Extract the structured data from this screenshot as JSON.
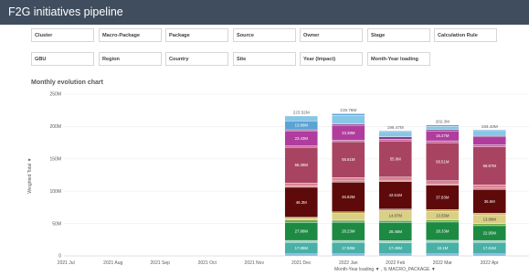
{
  "app": {
    "title": "F2G initiatives pipeline"
  },
  "filters": {
    "row1": [
      "Cluster",
      "Macro-Package",
      "Package",
      "Source",
      "Owner",
      "Stage",
      "Calculation Rule"
    ],
    "row2": [
      "GBU",
      "Region",
      "Country",
      "Site",
      "Year (Impact)",
      "Month-Year loading"
    ]
  },
  "chart_title": "Monthly evolution chart",
  "axis": {
    "ylabel": "Weighted Total",
    "ylabel_arrow": "▼",
    "xlabel": "Month-Year loading  ▼  , ⇅ MACRO_PACKAGE  ▼"
  },
  "colors": {
    "titlebar": "#3f4d5e",
    "blue": "#5ba3d5",
    "lightblue": "#88c6e6",
    "magenta": "#b03d9e",
    "rose": "#a84462",
    "darkred": "#5e0a0a",
    "khaki": "#dbcf86",
    "green": "#1d8a43",
    "teal": "#49b0a6"
  },
  "chart_data": {
    "type": "bar",
    "stacked": true,
    "ylim": [
      0,
      250
    ],
    "yticks": [
      "0",
      "50M",
      "100M",
      "150M",
      "200M",
      "250M"
    ],
    "categories": [
      "2021 Jul",
      "2021 Aug",
      "2021 Sep",
      "2021 Oct",
      "2021 Nov",
      "2021 Dec",
      "2022 Jan",
      "2022 Feb",
      "2022 Mar",
      "2022 Apr"
    ],
    "totals": [
      "",
      "",
      "",
      "",
      "",
      "223.52M",
      "219.76M",
      "196.47M",
      "202.3M",
      "193.43M"
    ],
    "stacks": [
      [],
      [],
      [],
      [],
      [],
      [
        {
          "value": 3,
          "color": "#7fb2dc"
        },
        {
          "value": 17.88,
          "color": "#49b0a6",
          "label": "17.88M"
        },
        {
          "value": 3,
          "color": "#9bd3bd"
        },
        {
          "value": 27.88,
          "color": "#1d8a43",
          "label": "27.88M"
        },
        {
          "value": 4,
          "color": "#6fae3f"
        },
        {
          "value": 2.5,
          "color": "#dbcf86"
        },
        {
          "value": 1.5,
          "color": "#b9a24a"
        },
        {
          "value": 46.3,
          "color": "#5e0a0a",
          "label": "46.3M"
        },
        {
          "value": 2,
          "color": "#c96b80"
        },
        {
          "value": 4.5,
          "color": "#d9838f"
        },
        {
          "value": 55.38,
          "color": "#a84462",
          "label": "55.38M"
        },
        {
          "value": 2,
          "color": "#c8609a"
        },
        {
          "value": 23.43,
          "color": "#b03d9e",
          "label": "23.43M"
        },
        {
          "value": 1.5,
          "color": "#8a3a8a"
        },
        {
          "value": 13.89,
          "color": "#5ba3d5",
          "label": "13.89M"
        },
        {
          "value": 7.46,
          "color": "#88c6e6"
        }
      ],
      [
        {
          "value": 3,
          "color": "#7fb2dc"
        },
        {
          "value": 17.88,
          "color": "#49b0a6",
          "label": "17.88M"
        },
        {
          "value": 3,
          "color": "#9bd3bd"
        },
        {
          "value": 28.23,
          "color": "#1d8a43",
          "label": "28.23M"
        },
        {
          "value": 3,
          "color": "#6fae3f"
        },
        {
          "value": 10.5,
          "color": "#dbcf86"
        },
        {
          "value": 2.5,
          "color": "#b9a24a"
        },
        {
          "value": 45.82,
          "color": "#5e0a0a",
          "label": "45.82M"
        },
        {
          "value": 2,
          "color": "#c96b80"
        },
        {
          "value": 5,
          "color": "#d9838f"
        },
        {
          "value": 55.61,
          "color": "#a84462",
          "label": "55.61M"
        },
        {
          "value": 2,
          "color": "#c8609a"
        },
        {
          "value": 23.38,
          "color": "#b03d9e",
          "label": "23.38M"
        },
        {
          "value": 2,
          "color": "#8a3a8a"
        },
        {
          "value": 13.35,
          "color": "#88c6e6"
        },
        {
          "value": 2.49,
          "color": "#5ba3d5"
        }
      ],
      [
        {
          "value": 3,
          "color": "#7fb2dc"
        },
        {
          "value": 17.49,
          "color": "#49b0a6",
          "label": "17.49M"
        },
        {
          "value": 3,
          "color": "#9bd3bd"
        },
        {
          "value": 28.46,
          "color": "#1d8a43",
          "label": "28.46M"
        },
        {
          "value": 3,
          "color": "#6fae3f"
        },
        {
          "value": 14.87,
          "color": "#dbcf86",
          "label": "14.87M"
        },
        {
          "value": 2.5,
          "color": "#b9a24a"
        },
        {
          "value": 42.51,
          "color": "#5e0a0a",
          "label": "42.51M"
        },
        {
          "value": 2,
          "color": "#c96b80"
        },
        {
          "value": 5,
          "color": "#d9838f"
        },
        {
          "value": 55.9,
          "color": "#a84462",
          "label": "55.9M"
        },
        {
          "value": 2.5,
          "color": "#c8609a"
        },
        {
          "value": 4,
          "color": "#8a3a8a"
        },
        {
          "value": 6.74,
          "color": "#88c6e6"
        },
        {
          "value": 2,
          "color": "#5ba3d5"
        }
      ],
      [
        {
          "value": 3,
          "color": "#7fb2dc"
        },
        {
          "value": 18.1,
          "color": "#49b0a6",
          "label": "18.1M"
        },
        {
          "value": 3,
          "color": "#9bd3bd"
        },
        {
          "value": 28.33,
          "color": "#1d8a43",
          "label": "28.33M"
        },
        {
          "value": 3,
          "color": "#6fae3f"
        },
        {
          "value": 13.55,
          "color": "#dbcf86",
          "label": "13.55M"
        },
        {
          "value": 2.5,
          "color": "#b9a24a"
        },
        {
          "value": 37.83,
          "color": "#5e0a0a",
          "label": "37.83M"
        },
        {
          "value": 2,
          "color": "#c96b80"
        },
        {
          "value": 5,
          "color": "#d9838f"
        },
        {
          "value": 58.51,
          "color": "#a84462",
          "label": "58.51M"
        },
        {
          "value": 3,
          "color": "#c8609a"
        },
        {
          "value": 15.27,
          "color": "#b03d9e",
          "label": "15.27M"
        },
        {
          "value": 2,
          "color": "#8a3a8a"
        },
        {
          "value": 5,
          "color": "#88c6e6"
        },
        {
          "value": 2.21,
          "color": "#5ba3d5"
        }
      ],
      [
        {
          "value": 3,
          "color": "#7fb2dc"
        },
        {
          "value": 17.81,
          "color": "#49b0a6",
          "label": "17.81M"
        },
        {
          "value": 3,
          "color": "#9bd3bd"
        },
        {
          "value": 22.95,
          "color": "#1d8a43",
          "label": "22.95M"
        },
        {
          "value": 3,
          "color": "#6fae3f"
        },
        {
          "value": 13.88,
          "color": "#dbcf86",
          "label": "13.88M"
        },
        {
          "value": 2.5,
          "color": "#b9a24a"
        },
        {
          "value": 36.5,
          "color": "#5e0a0a",
          "label": "36.5M"
        },
        {
          "value": 2,
          "color": "#c96b80"
        },
        {
          "value": 5,
          "color": "#d9838f"
        },
        {
          "value": 58.87,
          "color": "#a84462",
          "label": "58.87M"
        },
        {
          "value": 3,
          "color": "#c8609a"
        },
        {
          "value": 12.37,
          "color": "#b03d9e"
        },
        {
          "value": 2,
          "color": "#8a3a8a"
        },
        {
          "value": 6.55,
          "color": "#88c6e6"
        },
        {
          "value": 2,
          "color": "#5ba3d5"
        }
      ]
    ]
  }
}
